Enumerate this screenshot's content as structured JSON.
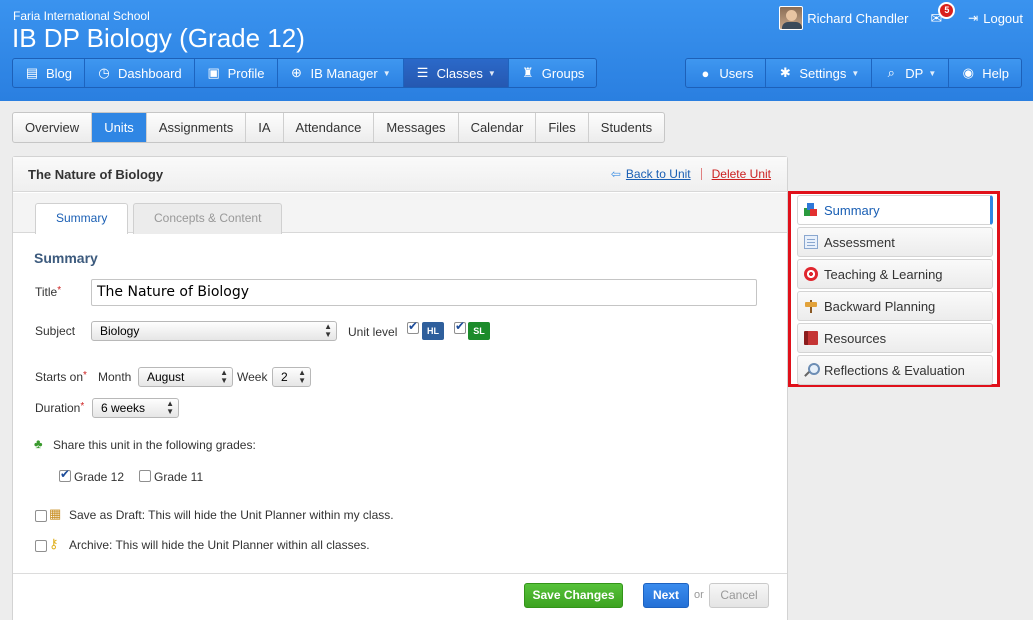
{
  "header": {
    "school": "Faria International School",
    "course": "IB DP Biology (Grade 12)",
    "user_name": "Richard Chandler",
    "mail_count": "5",
    "logout_label": "Logout"
  },
  "nav_left": [
    {
      "label": "Blog",
      "icon": "blog-icon"
    },
    {
      "label": "Dashboard",
      "icon": "dashboard-icon"
    },
    {
      "label": "Profile",
      "icon": "profile-icon"
    },
    {
      "label": "IB Manager",
      "icon": "globe-icon"
    },
    {
      "label": "Classes",
      "icon": "classes-icon"
    },
    {
      "label": "Groups",
      "icon": "trophy-icon"
    }
  ],
  "nav_right": [
    {
      "label": "Users",
      "icon": "user-icon"
    },
    {
      "label": "Settings",
      "icon": "gear-icon"
    },
    {
      "label": "DP",
      "icon": "search-icon"
    },
    {
      "label": "Help",
      "icon": "lifebuoy-icon"
    }
  ],
  "tabs": [
    "Overview",
    "Units",
    "Assignments",
    "IA",
    "Attendance",
    "Messages",
    "Calendar",
    "Files",
    "Students"
  ],
  "panel": {
    "title": "The Nature of Biology",
    "back_label": "Back to Unit",
    "delete_label": "Delete Unit",
    "subtabs": [
      "Summary",
      "Concepts & Content"
    ]
  },
  "form": {
    "section_title": "Summary",
    "title_label": "Title",
    "title_value": "The Nature of Biology",
    "subject_label": "Subject",
    "subject_value": "Biology",
    "unit_level_label": "Unit level",
    "level_hl": "HL",
    "level_sl": "SL",
    "starts_on_label": "Starts on",
    "month_label": "Month",
    "month_value": "August",
    "week_label": "Week",
    "week_value": "2",
    "duration_label": "Duration",
    "duration_value": "6 weeks",
    "share_label": "Share this unit in the following grades:",
    "grade12_label": "Grade 12",
    "grade11_label": "Grade 11",
    "draft_label": "Save as Draft: This will hide the Unit Planner within my class.",
    "archive_label": "Archive: This will hide the Unit Planner within all classes."
  },
  "footer": {
    "save_label": "Save Changes",
    "next_label": "Next",
    "or_label": "or",
    "cancel_label": "Cancel"
  },
  "sidemenu": [
    {
      "label": "Summary",
      "icon": "blocks-icon"
    },
    {
      "label": "Assessment",
      "icon": "document-icon"
    },
    {
      "label": "Teaching & Learning",
      "icon": "target-icon"
    },
    {
      "label": "Backward Planning",
      "icon": "signpost-icon"
    },
    {
      "label": "Resources",
      "icon": "book-icon"
    },
    {
      "label": "Reflections & Evaluation",
      "icon": "magnifier-icon"
    }
  ]
}
